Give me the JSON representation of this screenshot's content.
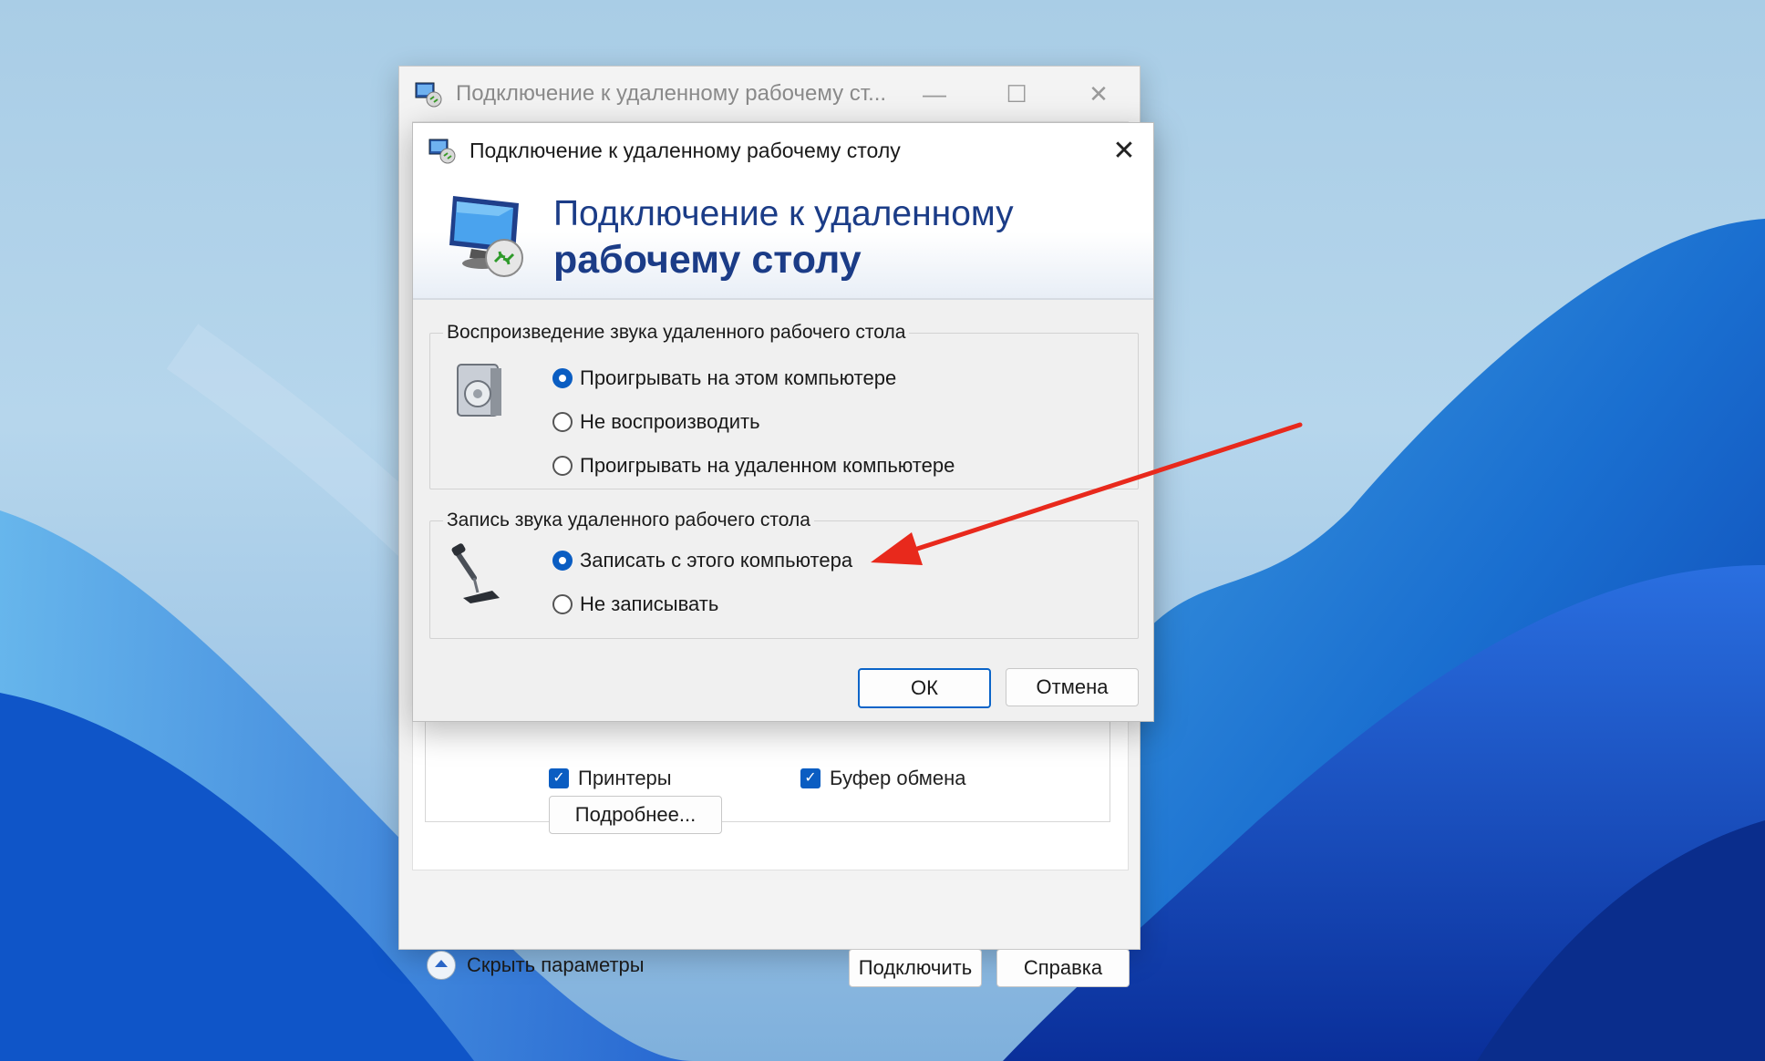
{
  "back_window": {
    "title": "Подключение к удаленному рабочему ст...",
    "minimize_glyph": "—",
    "maximize_glyph": "☐",
    "close_glyph": "✕",
    "checkbox_printers": "Принтеры",
    "checkbox_clipboard": "Буфер обмена",
    "more_button": "Подробнее...",
    "hide_params": "Скрыть параметры",
    "connect_button": "Подключить",
    "help_button": "Справка"
  },
  "dialog": {
    "title": "Подключение к удаленному рабочему столу",
    "close_glyph": "✕",
    "banner_line1": "Подключение к удаленному",
    "banner_line2": "рабочему столу",
    "playback": {
      "title": "Воспроизведение звука удаленного рабочего стола",
      "options": [
        {
          "label": "Проигрывать на этом компьютере",
          "selected": true
        },
        {
          "label": "Не воспроизводить",
          "selected": false
        },
        {
          "label": "Проигрывать на удаленном компьютере",
          "selected": false
        }
      ]
    },
    "recording": {
      "title": "Запись звука удаленного рабочего стола",
      "options": [
        {
          "label": "Записать с этого компьютера",
          "selected": true
        },
        {
          "label": "Не записывать",
          "selected": false
        }
      ]
    },
    "ok_button": "ОК",
    "cancel_button": "Отмена"
  },
  "colors": {
    "accent": "#0a5dc2",
    "banner_text": "#1b3c87",
    "annotation_arrow": "#e8291c"
  }
}
